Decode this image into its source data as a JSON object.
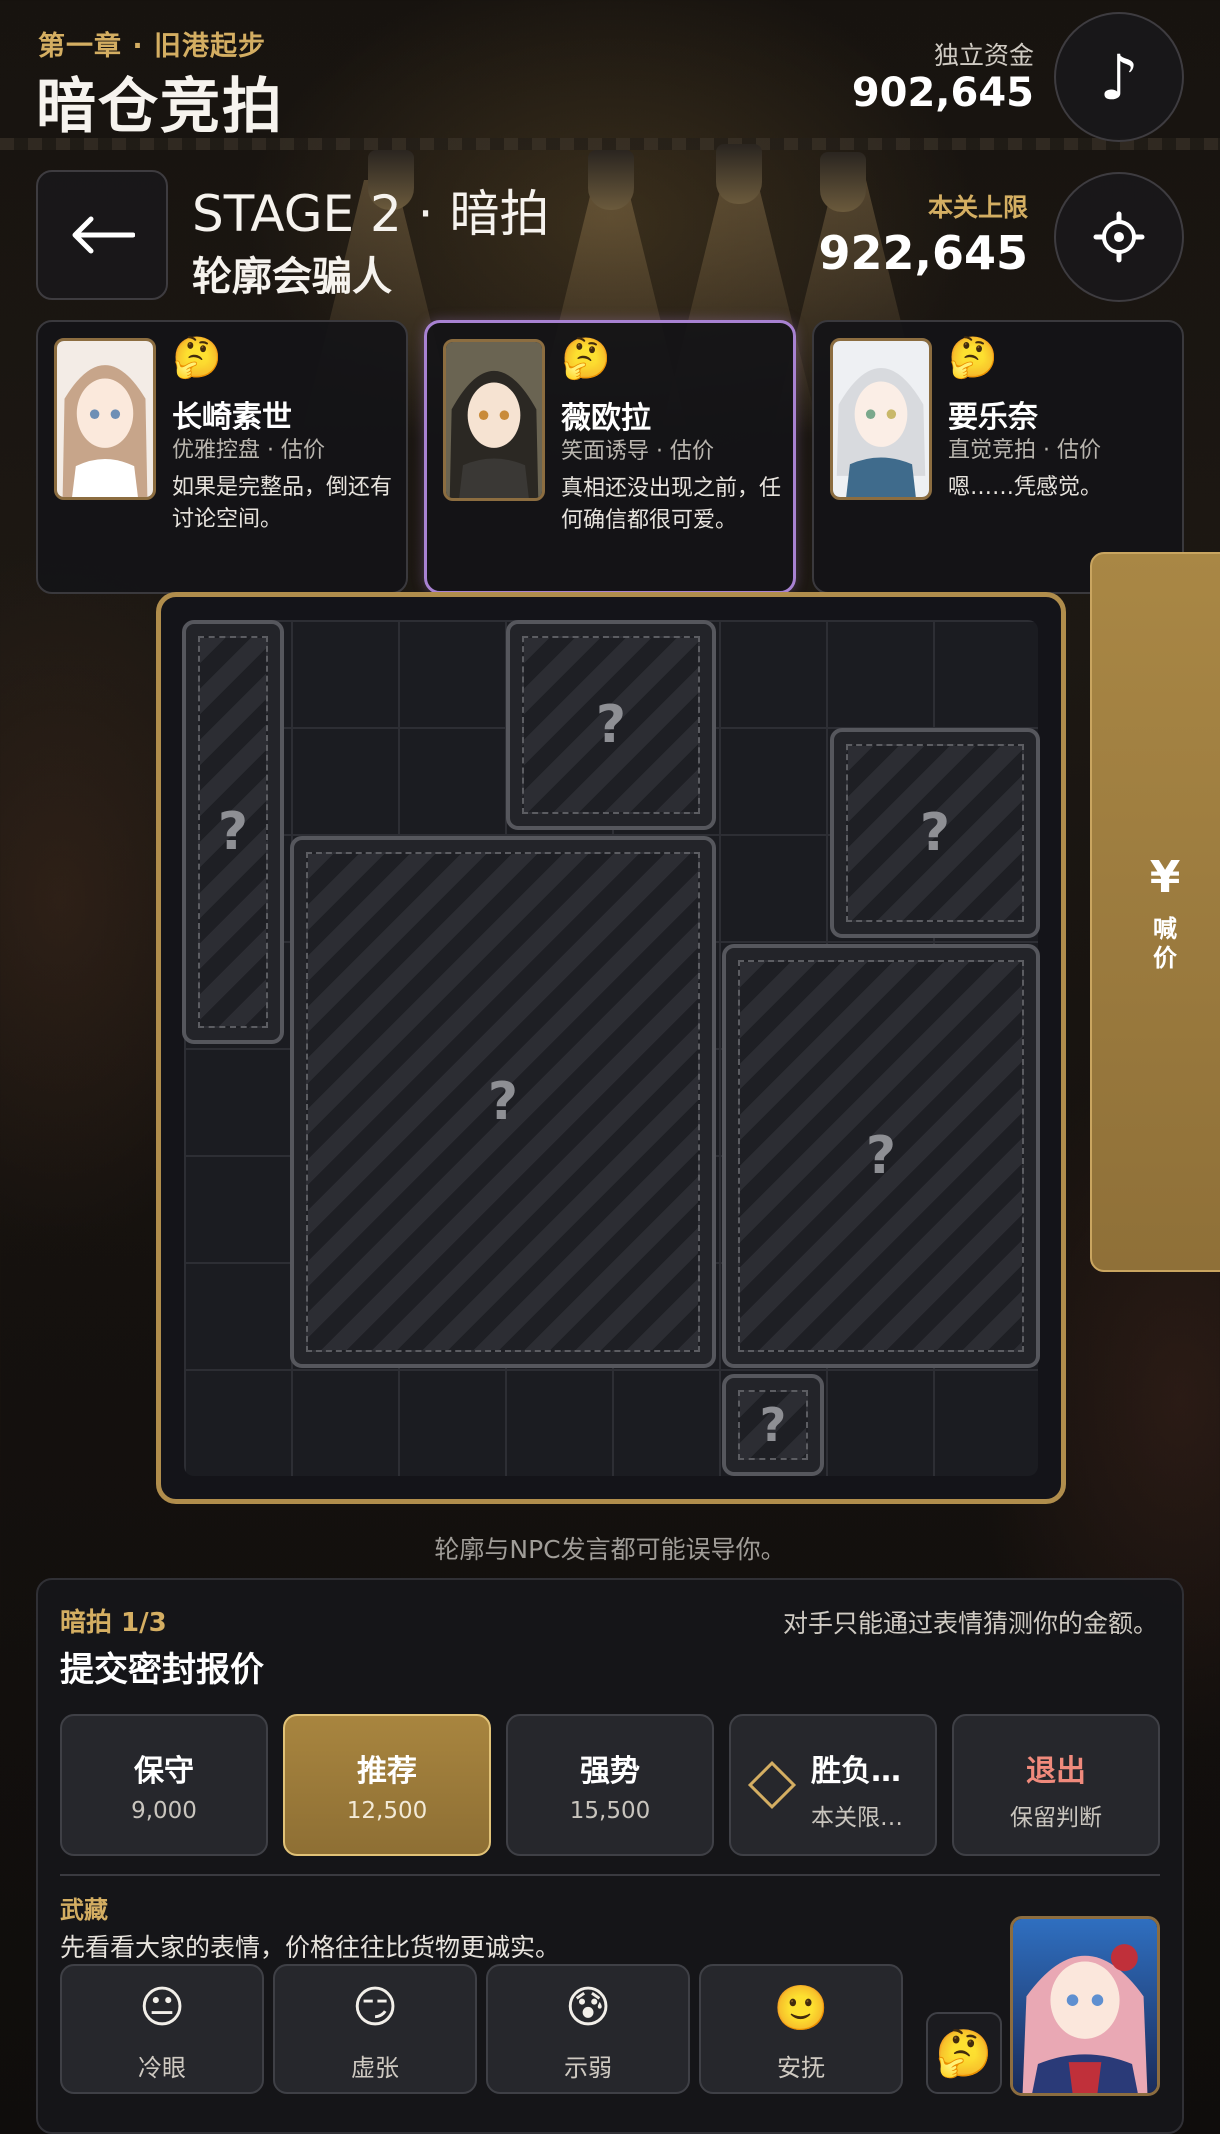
{
  "header": {
    "chapter": "第一章 · 旧港起步",
    "title": "暗仓竞拍",
    "funds_label": "独立资金",
    "funds_value": "902,645",
    "music_icon": "♪",
    "stage": "STAGE 2 · 暗拍",
    "subtitle": "轮廓会骗人",
    "limit_label": "本关上限",
    "limit_value": "922,645"
  },
  "npcs": [
    {
      "emoji": "🤔",
      "name": "长崎素世",
      "role": "优雅控盘 · 估价",
      "quote": "如果是完整品，倒还有讨论空间。"
    },
    {
      "emoji": "🤔",
      "name": "薇欧拉",
      "role": "笑面诱导 · 估价",
      "quote": "真相还没出现之前，任何确信都很可爱。"
    },
    {
      "emoji": "🤔",
      "name": "要乐奈",
      "role": "直觉竞拍 · 估价",
      "quote": "嗯……凭感觉。"
    }
  ],
  "board": {
    "unknown_mark": "?",
    "hint": "轮廓与NPC发言都可能误导你。"
  },
  "bid_tab": {
    "yen": "¥",
    "label": "喊价"
  },
  "panel": {
    "round": "暗拍 1/3",
    "title": "提交密封报价",
    "hint": "对手只能通过表情猜测你的金额。",
    "options": [
      {
        "label": "保守",
        "value": "9,000"
      },
      {
        "label": "推荐",
        "value": "12,500"
      },
      {
        "label": "强势",
        "value": "15,500"
      },
      {
        "label": "胜负…",
        "value": "本关限…"
      },
      {
        "label": "退出",
        "value": "保留判断"
      }
    ],
    "speaker": "武藏",
    "speaker_line": "先看看大家的表情，价格往往比货物更诚实。",
    "emotes": [
      {
        "face": "😐",
        "label": "冷眼"
      },
      {
        "face": "😏",
        "label": "虚张"
      },
      {
        "face": "😰",
        "label": "示弱"
      },
      {
        "face": "🙂",
        "label": "安抚"
      }
    ],
    "think_emoji": "🤔"
  },
  "colors": {
    "accent_gold": "#d4ae62",
    "active_purple": "#a882d2",
    "exit_red": "#f08a7c"
  }
}
